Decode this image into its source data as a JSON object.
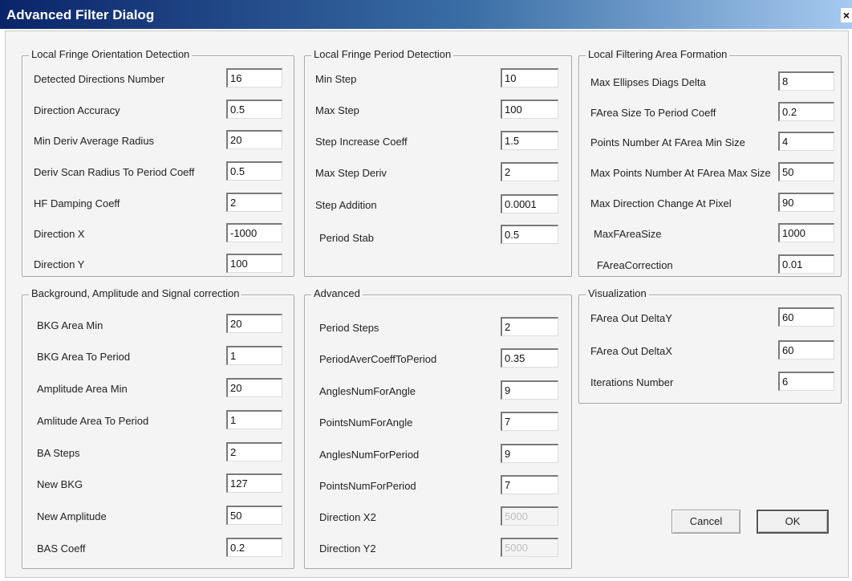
{
  "window": {
    "title": "Advanced Filter Dialog",
    "close_glyph": "×"
  },
  "groups": {
    "orientation": {
      "title": "Local Fringe Orientation Detection",
      "rows": [
        {
          "label": "Detected Directions Number",
          "value": "16"
        },
        {
          "label": "Direction Accuracy",
          "value": "0.5"
        },
        {
          "label": "Min Deriv Average Radius",
          "value": "20"
        },
        {
          "label": "Deriv Scan Radius To Period Coeff",
          "value": "0.5"
        },
        {
          "label": "HF Damping Coeff",
          "value": "2"
        },
        {
          "label": "Direction X",
          "value": "-1000"
        },
        {
          "label": "Direction Y",
          "value": "100"
        }
      ]
    },
    "period": {
      "title": "Local Fringe Period Detection",
      "rows": [
        {
          "label": "Min Step",
          "value": "10"
        },
        {
          "label": "Max Step",
          "value": "100"
        },
        {
          "label": "Step Increase Coeff",
          "value": "1.5"
        },
        {
          "label": "Max Step Deriv",
          "value": "2"
        },
        {
          "label": "Step Addition",
          "value": "0.0001"
        },
        {
          "label": "Period Stab",
          "value": "0.5"
        }
      ]
    },
    "filtering": {
      "title": "Local Filtering Area Formation",
      "rows": [
        {
          "label": "Max Ellipses Diags Delta",
          "value": "8"
        },
        {
          "label": "FArea Size To Period Coeff",
          "value": "0.2"
        },
        {
          "label": "Points Number At FArea Min Size",
          "value": "4"
        },
        {
          "label": "Max Points Number At FArea Max Size",
          "value": "50"
        },
        {
          "label": "Max Direction Change At Pixel",
          "value": "90"
        },
        {
          "label": "MaxFAreaSize",
          "value": "1000"
        },
        {
          "label": "FAreaCorrection",
          "value": "0.01"
        }
      ]
    },
    "background": {
      "title": "Background, Amplitude and Signal correction",
      "rows": [
        {
          "label": "BKG Area Min",
          "value": "20"
        },
        {
          "label": "BKG Area To Period",
          "value": "1"
        },
        {
          "label": "Amplitude Area Min",
          "value": "20"
        },
        {
          "label": "Amlitude Area To Period",
          "value": "1"
        },
        {
          "label": "BA Steps",
          "value": "2"
        },
        {
          "label": "New BKG",
          "value": "127"
        },
        {
          "label": "New Amplitude",
          "value": "50"
        },
        {
          "label": "BAS Coeff",
          "value": "0.2"
        }
      ]
    },
    "advanced": {
      "title": "Advanced",
      "rows": [
        {
          "label": "Period Steps",
          "value": "2"
        },
        {
          "label": "PeriodAverCoeffToPeriod",
          "value": "0.35"
        },
        {
          "label": "AnglesNumForAngle",
          "value": "9"
        },
        {
          "label": "PointsNumForAngle",
          "value": "7"
        },
        {
          "label": "AnglesNumForPeriod",
          "value": "9"
        },
        {
          "label": "PointsNumForPeriod",
          "value": "7"
        },
        {
          "label": "Direction X2",
          "value": "5000",
          "disabled": true
        },
        {
          "label": "Direction Y2",
          "value": "5000",
          "disabled": true
        }
      ]
    },
    "visualization": {
      "title": "Visualization",
      "rows": [
        {
          "label": "FArea Out DeltaY",
          "value": "60"
        },
        {
          "label": "FArea Out DeltaX",
          "value": "60"
        },
        {
          "label": "Iterations Number",
          "value": "6"
        }
      ]
    }
  },
  "buttons": {
    "cancel": "Cancel",
    "ok": "OK"
  }
}
